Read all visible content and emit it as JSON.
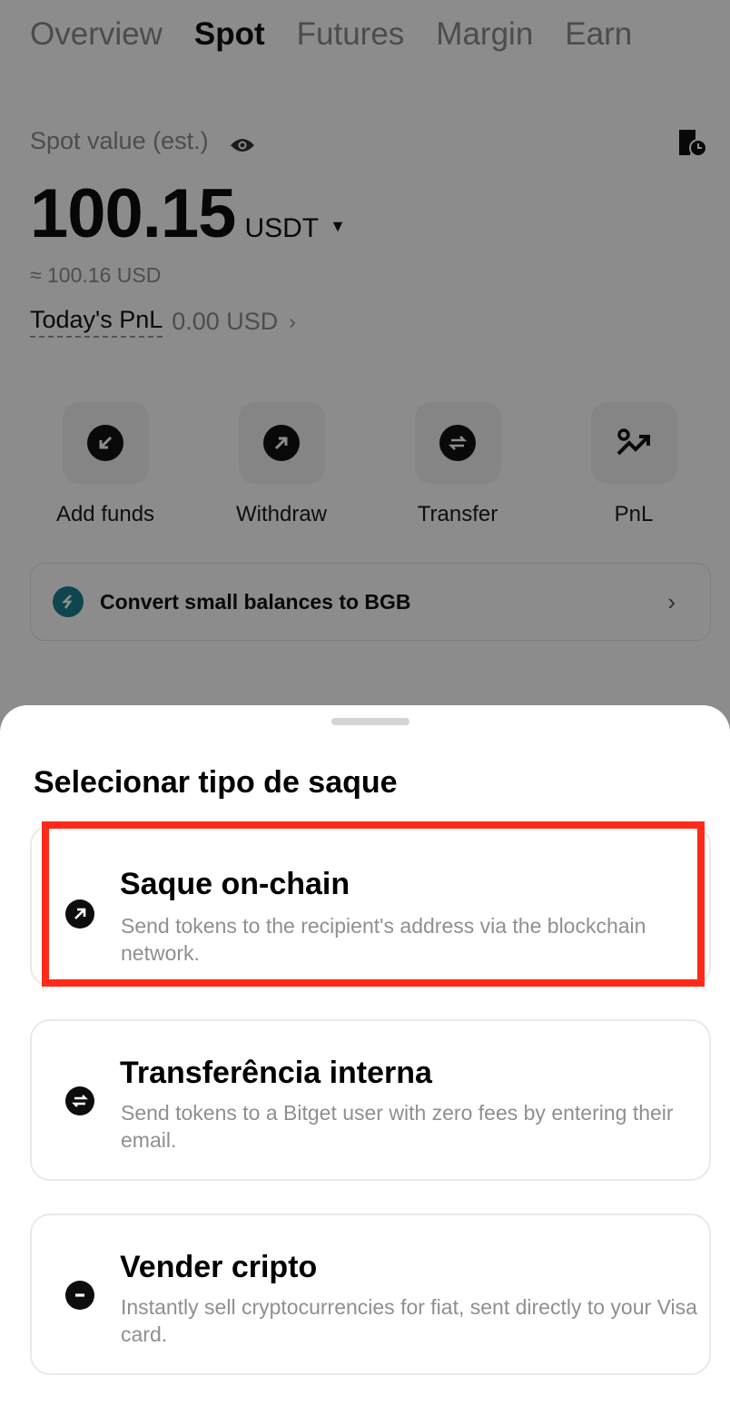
{
  "tabs": [
    {
      "label": "Overview",
      "active": false
    },
    {
      "label": "Spot",
      "active": true
    },
    {
      "label": "Futures",
      "active": false
    },
    {
      "label": "Margin",
      "active": false
    },
    {
      "label": "Earn",
      "active": false
    }
  ],
  "account": {
    "spot_label": "Spot value (est.)",
    "balance": "100.15",
    "unit": "USDT",
    "approx": "≈ 100.16 USD",
    "pnl_label": "Today's PnL",
    "pnl_value": "0.00 USD"
  },
  "actions": [
    {
      "label": "Add funds",
      "icon": "add-funds-icon"
    },
    {
      "label": "Withdraw",
      "icon": "withdraw-icon"
    },
    {
      "label": "Transfer",
      "icon": "transfer-icon"
    },
    {
      "label": "PnL",
      "icon": "pnl-icon"
    }
  ],
  "convert_banner": {
    "text": "Convert small balances to BGB"
  },
  "sheet": {
    "title": "Selecionar tipo de saque",
    "options": [
      {
        "title": "Saque on-chain",
        "description": "Send tokens to the recipient's address via the blockchain network.",
        "icon": "arrow-up-right-icon",
        "highlighted": true
      },
      {
        "title": "Transferência interna",
        "description": "Send tokens to a Bitget user with zero fees by entering their email.",
        "icon": "swap-icon",
        "highlighted": false
      },
      {
        "title": "Vender cripto",
        "description": "Instantly sell cryptocurrencies for fiat, sent directly to your Visa card.",
        "icon": "minus-icon",
        "highlighted": false
      }
    ]
  },
  "colors": {
    "highlight": "#ff2a1a",
    "overlay": "rgba(0,0,0,0.45)",
    "bgb_brand": "#1a7f8e"
  }
}
